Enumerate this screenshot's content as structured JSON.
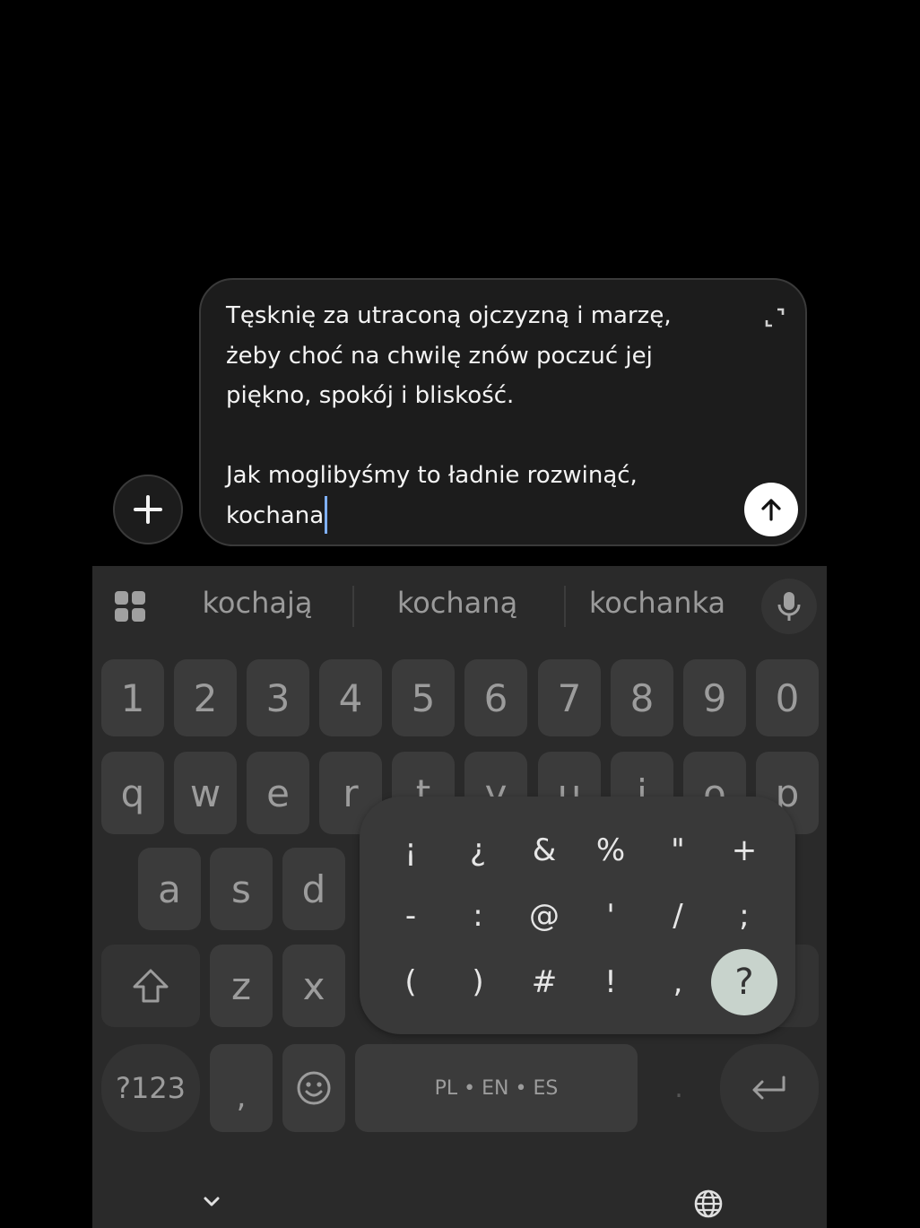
{
  "composer": {
    "text": "Tęsknię za utraconą ojczyzną i marzę,\nżeby choć na chwilę znów poczuć jej\npiękno, spokój i bliskość.\n\nJak moglibyśmy to ładnie rozwinąć,\nkochana"
  },
  "suggestions": [
    "kochają",
    "kochaną",
    "kochanka"
  ],
  "number_row": [
    "1",
    "2",
    "3",
    "4",
    "5",
    "6",
    "7",
    "8",
    "9",
    "0"
  ],
  "row_q": [
    "q",
    "w",
    "e",
    "r",
    "t",
    "y",
    "u",
    "i",
    "o",
    "p"
  ],
  "row_a": [
    "a",
    "s",
    "d"
  ],
  "row_z": [
    "z",
    "x"
  ],
  "bottom_row": {
    "symbols_label": "?123",
    "comma": ",",
    "space_label": "PL • EN • ES",
    "period": "."
  },
  "popup_symbols": [
    [
      "¡",
      "¿",
      "&",
      "%",
      "\"",
      "+"
    ],
    [
      "-",
      ":",
      "@",
      "'",
      "/",
      ";"
    ],
    [
      "(",
      ")",
      "#",
      "!",
      ",",
      "?"
    ]
  ],
  "popup_selected": "?",
  "icons": {
    "plus": "plus-icon",
    "expand": "expand-icon",
    "send": "arrow-up-icon",
    "apps": "apps-grid-icon",
    "mic": "microphone-icon",
    "shift": "shift-icon",
    "emoji": "emoji-icon",
    "enter": "enter-icon",
    "hide_keyboard": "chevron-down-icon",
    "language": "globe-icon"
  }
}
